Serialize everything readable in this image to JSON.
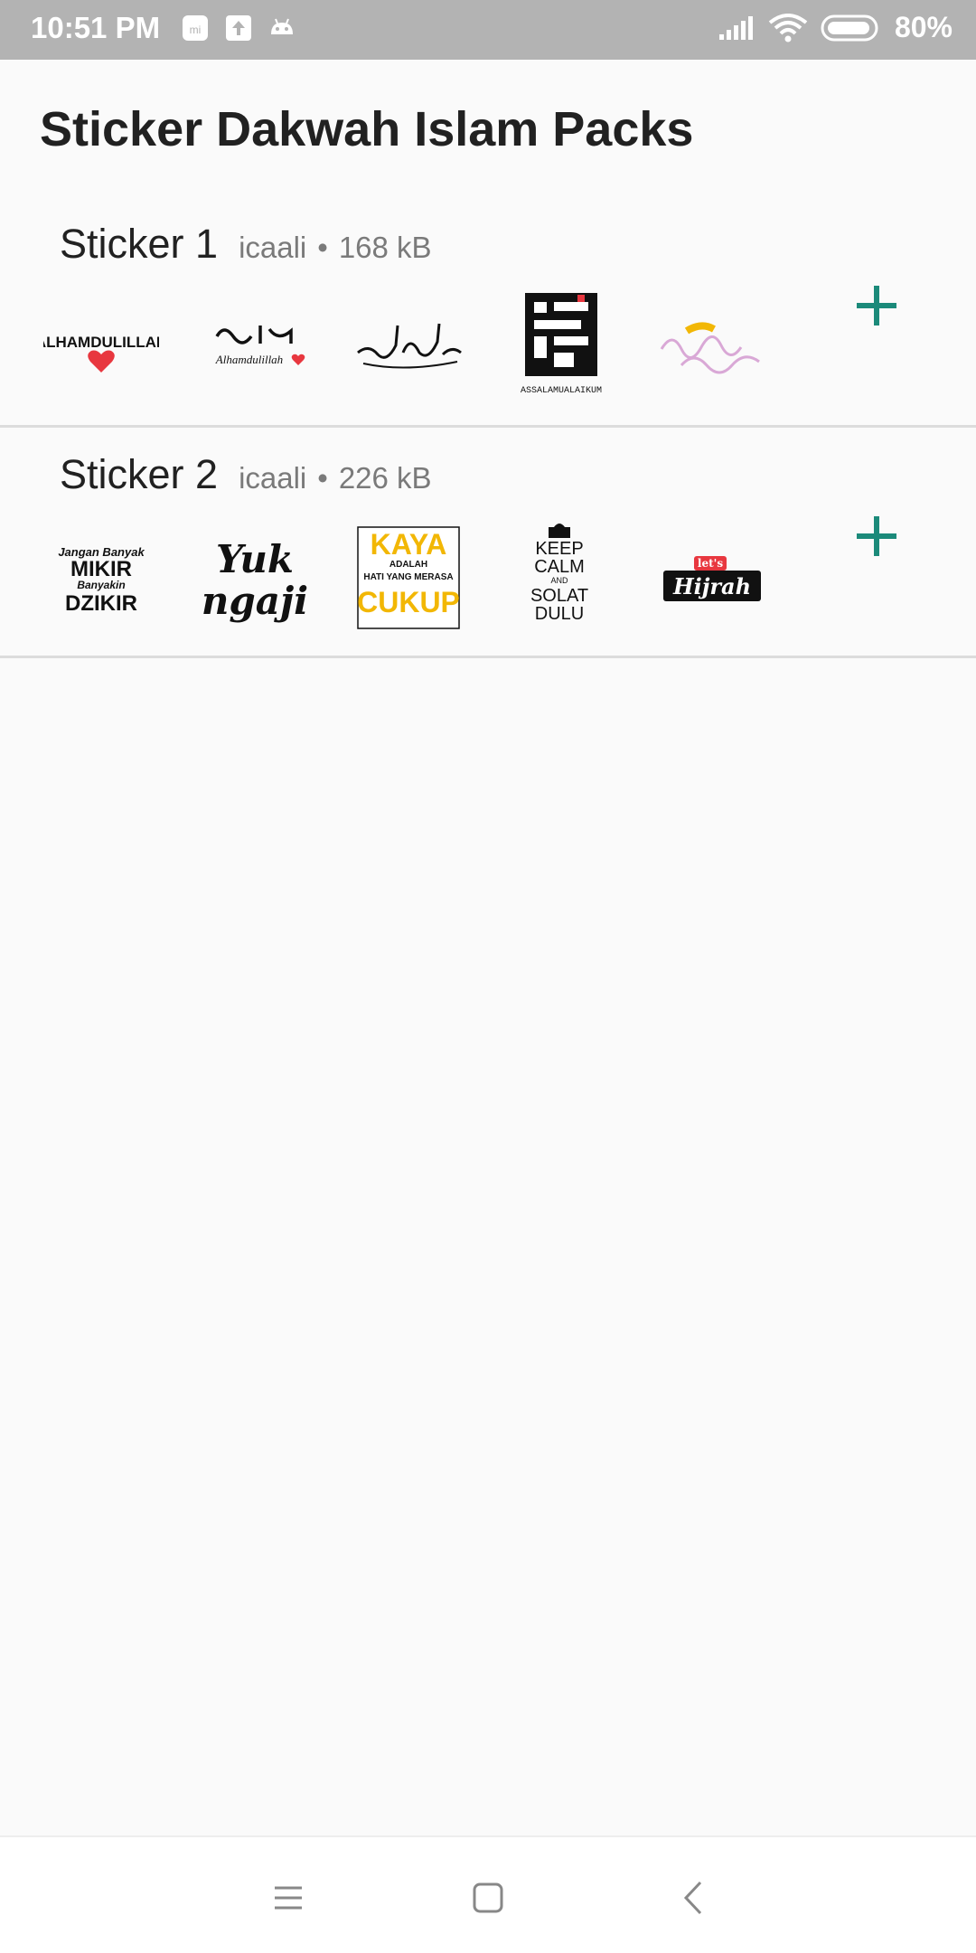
{
  "status_bar": {
    "time": "10:51 PM",
    "battery": "80%",
    "left_icons": [
      "mi-icon",
      "upload-icon",
      "android-icon"
    ],
    "right_icons": [
      "signal-icon",
      "wifi-icon",
      "battery-icon"
    ]
  },
  "header": {
    "title": "Sticker Dakwah Islam Packs"
  },
  "packs": [
    {
      "name": "Sticker 1",
      "publisher": "icaali",
      "separator": "•",
      "size": "168 kB",
      "stickers": [
        {
          "icon": "sticker-alhamdulillah-heart",
          "text": "ALHAMDULILLAH"
        },
        {
          "icon": "sticker-alhamdulillah-arabic",
          "text": "Alhamdulillah"
        },
        {
          "icon": "sticker-bismillah-calligraphy"
        },
        {
          "icon": "sticker-assalamualaikum-kufic",
          "text": "ASSALAMUALAIKUM"
        },
        {
          "icon": "sticker-pink-script"
        }
      ],
      "add_icon": "plus-icon"
    },
    {
      "name": "Sticker 2",
      "publisher": "icaali",
      "separator": "•",
      "size": "226 kB",
      "stickers": [
        {
          "icon": "sticker-mikir-dzikir",
          "lines": [
            "Jangan Banyak",
            "MIKIR",
            "Banyakin",
            "DZIKIR"
          ]
        },
        {
          "icon": "sticker-yuk-ngaji",
          "lines": [
            "Yuk",
            "ngaji"
          ]
        },
        {
          "icon": "sticker-kaya-cukup",
          "lines": [
            "KAYA",
            "ADALAH",
            "HATI YANG MERASA",
            "CUKUP"
          ]
        },
        {
          "icon": "sticker-keep-calm-solat",
          "lines": [
            "KEEP",
            "CALM",
            "AND",
            "SOLAT",
            "DULU"
          ]
        },
        {
          "icon": "sticker-lets-hijrah",
          "lines": [
            "let's",
            "Hijrah"
          ]
        }
      ],
      "add_icon": "plus-icon"
    }
  ],
  "nav_bar": {
    "buttons": [
      "menu-icon",
      "home-icon",
      "back-icon"
    ]
  },
  "colors": {
    "accent": "#1b8a7a",
    "status_bar": "#b3b3b3",
    "background": "#fafafa",
    "divider": "#dcdcdc",
    "sticker_yellow": "#f2b705",
    "heart_red": "#e8373f",
    "pink_script": "#d9a8d6"
  }
}
